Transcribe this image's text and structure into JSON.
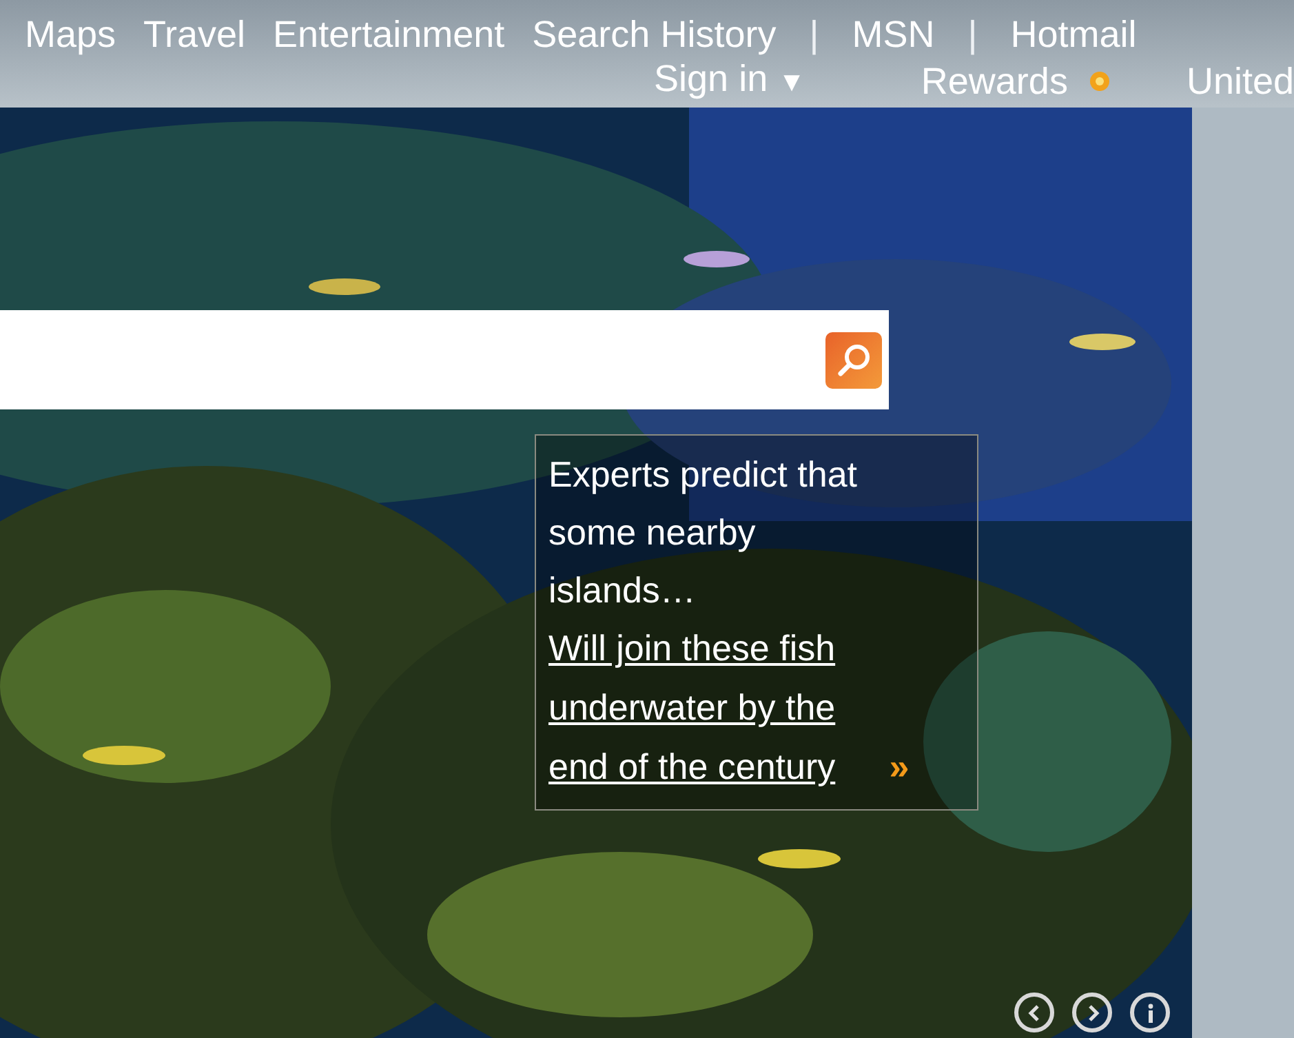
{
  "top_nav": {
    "links": [
      {
        "kind": "link",
        "label": "Maps"
      },
      {
        "kind": "link",
        "label": "Travel"
      },
      {
        "kind": "link",
        "label": "Entertainment"
      },
      {
        "kind": "link",
        "label": "Search History"
      },
      {
        "kind": "separator",
        "label": "|"
      },
      {
        "kind": "link",
        "label": "MSN"
      },
      {
        "kind": "separator",
        "label": "|"
      },
      {
        "kind": "link",
        "label": "Hotmail"
      }
    ],
    "sign_in": {
      "label": "Sign in",
      "caret": "▼"
    },
    "rewards": {
      "label": "Rewards"
    },
    "region": {
      "label": "United"
    }
  },
  "hero": {
    "kind": "picture",
    "caption": {
      "text": "Experts predict that some nearby islands…",
      "link": "Will join these fish underwater by the end of the century",
      "more": "»"
    }
  }
}
